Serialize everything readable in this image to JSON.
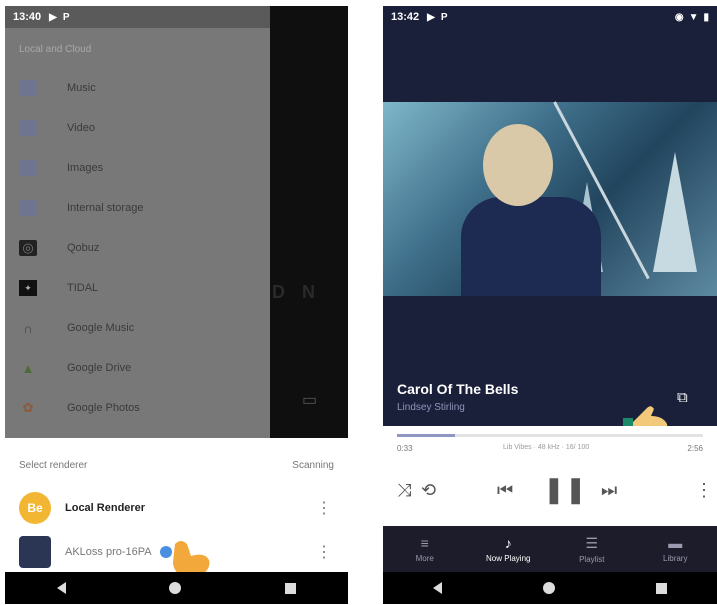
{
  "left": {
    "status": {
      "time": "13:40"
    },
    "drawer": {
      "section_title": "Local and Cloud",
      "items": [
        {
          "label": "Music",
          "icon": "folder-icon"
        },
        {
          "label": "Video",
          "icon": "folder-icon"
        },
        {
          "label": "Images",
          "icon": "folder-icon"
        },
        {
          "label": "Internal storage",
          "icon": "folder-icon"
        },
        {
          "label": "Qobuz",
          "icon": "qobuz-icon"
        },
        {
          "label": "TIDAL",
          "icon": "tidal-icon"
        },
        {
          "label": "Google Music",
          "icon": "headphones-icon"
        },
        {
          "label": "Google Drive",
          "icon": "google-drive-icon"
        },
        {
          "label": "Google Photos",
          "icon": "google-photos-icon"
        }
      ]
    },
    "renderer_sheet": {
      "title": "Select renderer",
      "status": "Scanning",
      "renderers": [
        {
          "name": "Local Renderer",
          "avatar_text": "Be",
          "avatar_color": "#f2b632"
        },
        {
          "name": "AKLoss pro-16PA",
          "avatar_color": "#2b3655"
        }
      ]
    }
  },
  "right": {
    "status": {
      "time": "13:42"
    },
    "track": {
      "title": "Carol Of The Bells",
      "artist": "Lindsey Stirling"
    },
    "progress": {
      "elapsed": "0:33",
      "total": "2:56",
      "fraction": 0.19,
      "meta": "Lib Vibes · 48 kHz · 16/ 100"
    },
    "tabs": [
      {
        "label": "More",
        "icon": "menu-icon"
      },
      {
        "label": "Now Playing",
        "icon": "music-note-icon",
        "active": true
      },
      {
        "label": "Playlist",
        "icon": "playlist-icon"
      },
      {
        "label": "Library",
        "icon": "folder-icon"
      }
    ]
  },
  "colors": {
    "player_bg": "#1a1f3a",
    "accent": "#8e96c4",
    "local_renderer_badge": "#f2b632"
  }
}
